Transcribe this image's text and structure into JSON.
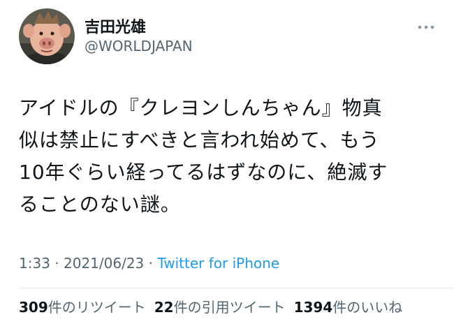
{
  "tweet": {
    "author": {
      "display_name": "吉田光雄",
      "handle": "@WORLDJAPAN"
    },
    "text_lines": [
      "アイドルの『クレヨンしんちゃん』物真",
      "似は禁止にすべきと言われ始めて、もう",
      "10年ぐらい経ってるはずなのに、絶滅す",
      "ることのない謎。"
    ],
    "timestamp": {
      "time": "1:33",
      "date": "2021/06/23",
      "separator": "·",
      "source": "Twitter for iPhone"
    },
    "stats": {
      "retweets": {
        "count": "309",
        "label": "件のリツイート"
      },
      "quotes": {
        "count": "22",
        "label": "件の引用ツイート"
      },
      "likes": {
        "count": "1394",
        "label": "件のいいね"
      }
    },
    "icons": {
      "more": "more-horizontal-icon",
      "avatar": "pig-character-avatar"
    }
  }
}
